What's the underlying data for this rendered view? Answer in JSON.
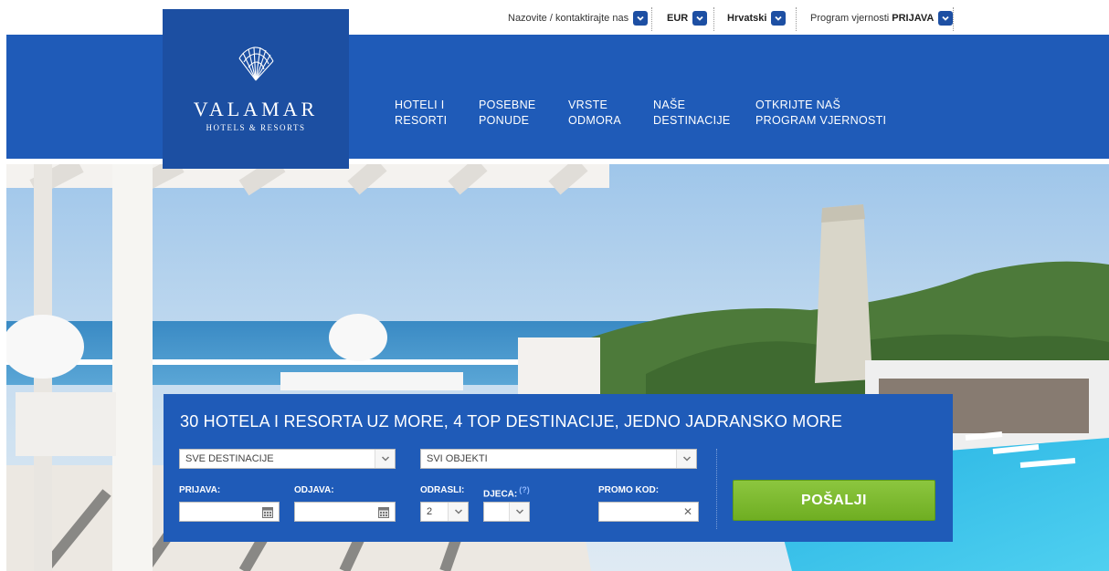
{
  "topbar": {
    "contact_label": "Nazovite / kontaktirajte nas",
    "currency": "EUR",
    "language": "Hrvatski",
    "loyalty_label": "Program vjernosti",
    "loyalty_login": "PRIJAVA"
  },
  "brand": {
    "name": "VALAMAR",
    "tagline": "HOTELS & RESORTS"
  },
  "nav": {
    "items": [
      {
        "line1": "HOTELI I",
        "line2": "RESORTI"
      },
      {
        "line1": "POSEBNE",
        "line2": "PONUDE"
      },
      {
        "line1": "VRSTE",
        "line2": "ODMORA"
      },
      {
        "line1": "NAŠE",
        "line2": "DESTINACIJE"
      },
      {
        "line1": "OTKRIJTE NAŠ",
        "line2": "PROGRAM VJERNOSTI"
      }
    ]
  },
  "booking": {
    "title": "30 HOTELA I RESORTA UZ MORE, 4 TOP DESTINACIJE, JEDNO JADRANSKO MORE",
    "destination_value": "SVE DESTINACIJE",
    "property_value": "SVI OBJEKTI",
    "checkin_label": "PRIJAVA:",
    "checkout_label": "ODJAVA:",
    "adults_label": "ODRASLI:",
    "adults_value": "2",
    "children_label": "DJECA:",
    "children_help": "(?)",
    "children_value": "",
    "promo_label": "PROMO KOD:",
    "submit_label": "POŠALJI"
  },
  "colors": {
    "brand_blue": "#1f5bb8",
    "logo_blue": "#1c4fa2",
    "submit_green": "#7cba2e"
  }
}
